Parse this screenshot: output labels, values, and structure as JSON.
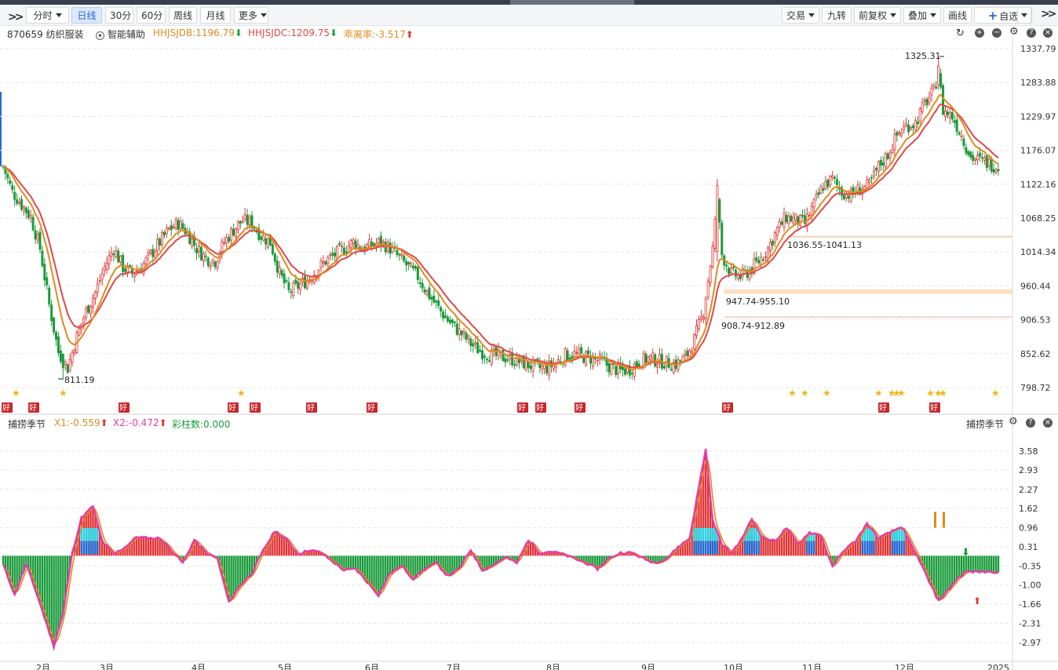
{
  "toolbar": {
    "left_buttons": [
      {
        "label": "分时",
        "dropdown": true
      },
      {
        "label": "日线",
        "active": true
      },
      {
        "label": "30分"
      },
      {
        "label": "60分"
      },
      {
        "label": "周线"
      },
      {
        "label": "月线"
      },
      {
        "label": "更多",
        "dropdown": true
      }
    ],
    "right_buttons": [
      {
        "label": "交易",
        "dropdown": true
      },
      {
        "label": "九转"
      },
      {
        "label": "前复权",
        "dropdown": true
      },
      {
        "label": "叠加",
        "dropdown": true
      },
      {
        "label": "画线"
      },
      {
        "label": "自选",
        "plus": true
      }
    ]
  },
  "info": {
    "stock": "870659 纺织服装",
    "assist": "智能辅助",
    "hhjsjdb": "HHJSJDB:1196.79",
    "hhjsjdc": "HHJSJDC:1209.75",
    "guailil": "乖离率:-3.517"
  },
  "sub": {
    "name": "捕捞季节",
    "x1": "X1:-0.559",
    "x2": "X2:-0.472",
    "caizhu": "彩柱数:0.000",
    "right_name": "捕捞季节"
  },
  "colors": {
    "up": "#e03434",
    "down": "#1a9b3b",
    "line_orange": "#e08a1e",
    "line_red": "#e04848",
    "line_magenta": "#e83aa8",
    "cyan": "#23d7e8",
    "blue": "#1e6fd9",
    "gold": "#f2b519"
  },
  "chart_data": [
    {
      "type": "candlestick",
      "y_axis_ticks": [
        "1337.79",
        "1283.88",
        "1229.97",
        "1176.07",
        "1122.16",
        "1068.25",
        "1014.34",
        "960.44",
        "906.53",
        "852.62",
        "798.72"
      ],
      "ylim": [
        798.72,
        1337.79
      ],
      "annotations": [
        "1325.31",
        "811.19",
        "1036.55-1041.13",
        "947.74-955.10",
        "908.74-912.89"
      ],
      "signal_label": "好",
      "series": [
        {
          "name": "HHJSJDB",
          "last": 1196.79
        },
        {
          "name": "HHJSJDC",
          "last": 1209.75
        }
      ],
      "x_labels": [
        "2月",
        "3月",
        "4月",
        "5月",
        "6月",
        "7月",
        "8月",
        "9月",
        "10月",
        "11月",
        "12月",
        "2025"
      ],
      "anchors": [
        [
          0,
          1150
        ],
        [
          4,
          1110
        ],
        [
          8,
          1090
        ],
        [
          12,
          1070
        ],
        [
          16,
          1020
        ],
        [
          20,
          930
        ],
        [
          24,
          855
        ],
        [
          28,
          830
        ],
        [
          32,
          880
        ],
        [
          36,
          920
        ],
        [
          40,
          950
        ],
        [
          44,
          990
        ],
        [
          48,
          1020
        ],
        [
          52,
          990
        ],
        [
          56,
          980
        ],
        [
          60,
          990
        ],
        [
          64,
          1010
        ],
        [
          68,
          1030
        ],
        [
          72,
          1050
        ],
        [
          76,
          1060
        ],
        [
          80,
          1045
        ],
        [
          84,
          1020
        ],
        [
          88,
          1005
        ],
        [
          92,
          1000
        ],
        [
          96,
          1030
        ],
        [
          100,
          1050
        ],
        [
          104,
          1065
        ],
        [
          108,
          1060
        ],
        [
          112,
          1040
        ],
        [
          116,
          1030
        ],
        [
          120,
          980
        ],
        [
          124,
          950
        ],
        [
          128,
          960
        ],
        [
          132,
          970
        ],
        [
          136,
          985
        ],
        [
          140,
          1000
        ],
        [
          144,
          1010
        ],
        [
          148,
          1020
        ],
        [
          152,
          1030
        ],
        [
          156,
          1020
        ],
        [
          160,
          1025
        ],
        [
          164,
          1030
        ],
        [
          168,
          1020
        ],
        [
          172,
          1005
        ],
        [
          176,
          990
        ],
        [
          180,
          975
        ],
        [
          184,
          950
        ],
        [
          188,
          930
        ],
        [
          192,
          910
        ],
        [
          196,
          895
        ],
        [
          200,
          880
        ],
        [
          204,
          865
        ],
        [
          208,
          855
        ],
        [
          212,
          850
        ],
        [
          216,
          848
        ],
        [
          220,
          845
        ],
        [
          224,
          840
        ],
        [
          228,
          835
        ],
        [
          232,
          830
        ],
        [
          236,
          830
        ],
        [
          240,
          838
        ],
        [
          244,
          850
        ],
        [
          248,
          852
        ],
        [
          252,
          848
        ],
        [
          256,
          845
        ],
        [
          260,
          840
        ],
        [
          264,
          830
        ],
        [
          268,
          825
        ],
        [
          272,
          828
        ],
        [
          276,
          840
        ],
        [
          280,
          845
        ],
        [
          284,
          842
        ],
        [
          288,
          838
        ],
        [
          292,
          836
        ],
        [
          296,
          845
        ],
        [
          300,
          875
        ],
        [
          304,
          920
        ],
        [
          308,
          1020
        ],
        [
          310,
          1100
        ],
        [
          312,
          1010
        ],
        [
          316,
          980
        ],
        [
          320,
          975
        ],
        [
          324,
          985
        ],
        [
          328,
          1000
        ],
        [
          332,
          1020
        ],
        [
          336,
          1050
        ],
        [
          340,
          1070
        ],
        [
          344,
          1065
        ],
        [
          348,
          1060
        ],
        [
          352,
          1090
        ],
        [
          356,
          1120
        ],
        [
          360,
          1130
        ],
        [
          364,
          1110
        ],
        [
          368,
          1105
        ],
        [
          372,
          1115
        ],
        [
          376,
          1120
        ],
        [
          380,
          1150
        ],
        [
          384,
          1170
        ],
        [
          388,
          1200
        ],
        [
          392,
          1215
        ],
        [
          396,
          1220
        ],
        [
          400,
          1250
        ],
        [
          404,
          1270
        ],
        [
          406,
          1300
        ],
        [
          408,
          1240
        ],
        [
          412,
          1230
        ],
        [
          416,
          1200
        ],
        [
          420,
          1165
        ],
        [
          424,
          1160
        ],
        [
          428,
          1155
        ],
        [
          432,
          1150
        ]
      ],
      "ema_fast_span": 10,
      "ema_slow_span": 16
    },
    {
      "type": "histogram_lines",
      "name": "捕捞季节",
      "y_axis_ticks": [
        "3.58",
        "2.93",
        "2.27",
        "1.62",
        "0.96",
        "0.31",
        "-0.35",
        "-1.00",
        "-1.66",
        "-2.31",
        "-2.97"
      ],
      "ylim": [
        -2.97,
        3.58
      ],
      "series": [
        {
          "name": "X1",
          "last": -0.559
        },
        {
          "name": "X2",
          "last": -0.472
        },
        {
          "name": "彩柱数",
          "last": 0.0
        }
      ],
      "anchors": [
        [
          0,
          -0.3
        ],
        [
          5,
          -1.35
        ],
        [
          10,
          -0.3
        ],
        [
          15,
          -1.4
        ],
        [
          22,
          -3.1
        ],
        [
          26,
          -2.0
        ],
        [
          30,
          0.1
        ],
        [
          34,
          1.3
        ],
        [
          39,
          1.7
        ],
        [
          43,
          0.5
        ],
        [
          48,
          0.05
        ],
        [
          53,
          0.3
        ],
        [
          58,
          0.65
        ],
        [
          63,
          0.6
        ],
        [
          68,
          0.6
        ],
        [
          73,
          0.2
        ],
        [
          78,
          -0.25
        ],
        [
          83,
          0.55
        ],
        [
          88,
          0.1
        ],
        [
          93,
          -0.1
        ],
        [
          98,
          -1.6
        ],
        [
          103,
          -1.0
        ],
        [
          108,
          -0.6
        ],
        [
          113,
          0.2
        ],
        [
          118,
          0.85
        ],
        [
          123,
          0.55
        ],
        [
          128,
          0.05
        ],
        [
          133,
          0.2
        ],
        [
          138,
          0.1
        ],
        [
          143,
          -0.2
        ],
        [
          148,
          -0.5
        ],
        [
          153,
          -0.45
        ],
        [
          158,
          -0.9
        ],
        [
          163,
          -1.35
        ],
        [
          168,
          -0.6
        ],
        [
          173,
          -0.35
        ],
        [
          178,
          -0.8
        ],
        [
          183,
          -0.45
        ],
        [
          188,
          -0.25
        ],
        [
          193,
          -0.7
        ],
        [
          198,
          -0.45
        ],
        [
          203,
          0.2
        ],
        [
          208,
          -0.5
        ],
        [
          213,
          -0.3
        ],
        [
          218,
          -0.05
        ],
        [
          223,
          -0.25
        ],
        [
          228,
          0.55
        ],
        [
          233,
          0.1
        ],
        [
          238,
          0.15
        ],
        [
          243,
          0.05
        ],
        [
          248,
          -0.1
        ],
        [
          253,
          -0.25
        ],
        [
          258,
          -0.45
        ],
        [
          263,
          -0.1
        ],
        [
          268,
          0.1
        ],
        [
          273,
          0.1
        ],
        [
          278,
          -0.1
        ],
        [
          283,
          -0.25
        ],
        [
          288,
          -0.1
        ],
        [
          293,
          0.3
        ],
        [
          298,
          0.6
        ],
        [
          303,
          2.8
        ],
        [
          305,
          3.65
        ],
        [
          308,
          1.2
        ],
        [
          312,
          0.4
        ],
        [
          316,
          0.1
        ],
        [
          320,
          0.5
        ],
        [
          325,
          1.25
        ],
        [
          330,
          0.6
        ],
        [
          335,
          0.5
        ],
        [
          340,
          0.95
        ],
        [
          345,
          0.4
        ],
        [
          350,
          0.8
        ],
        [
          355,
          0.7
        ],
        [
          360,
          -0.4
        ],
        [
          365,
          0.2
        ],
        [
          370,
          0.5
        ],
        [
          375,
          1.1
        ],
        [
          380,
          0.6
        ],
        [
          385,
          0.8
        ],
        [
          390,
          1.0
        ],
        [
          394,
          0.4
        ],
        [
          398,
          -0.2
        ],
        [
          402,
          -0.9
        ],
        [
          406,
          -1.55
        ],
        [
          410,
          -1.2
        ],
        [
          414,
          -0.8
        ],
        [
          418,
          -0.55
        ]
      ]
    }
  ]
}
